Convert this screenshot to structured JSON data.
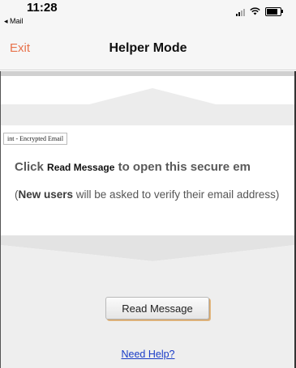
{
  "status_bar": {
    "time": "11:28",
    "back_label": "◂ Mail"
  },
  "navbar": {
    "exit_label": "Exit",
    "title": "Helper Mode",
    "exit_color": "#e8724b"
  },
  "message": {
    "brand_label": "int - Encrypted Email",
    "click_prefix": "Click",
    "click_button_name": "Read Message",
    "click_suffix": "to open this secure em",
    "note_open": "(",
    "note_bold": "New users",
    "note_rest": " will be asked to verify their email address)"
  },
  "actions": {
    "read_message_label": "Read Message",
    "need_help_label": "Need Help?"
  },
  "icons": {
    "signal": "signal-icon",
    "wifi": "wifi-icon",
    "battery": "battery-icon"
  }
}
